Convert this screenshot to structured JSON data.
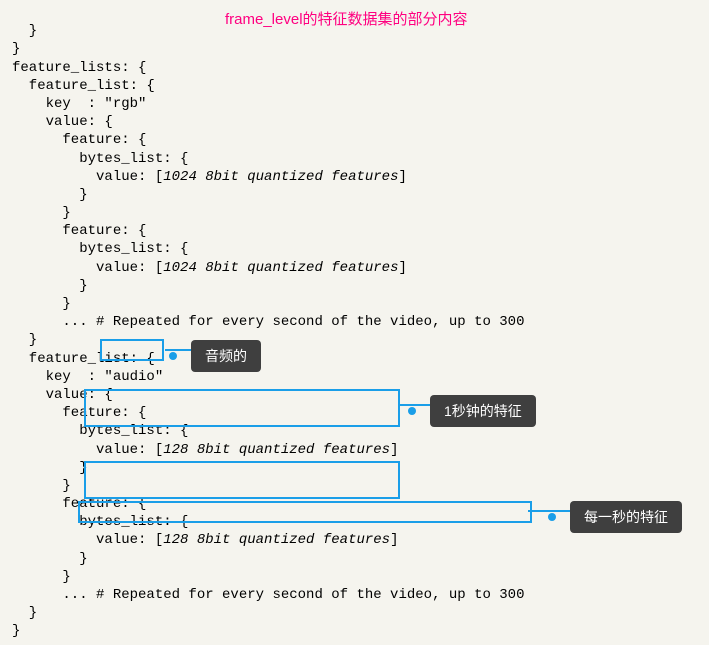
{
  "title": "frame_level的特征数据集的部分内容",
  "code": {
    "l1": "  }",
    "l2": "}",
    "l3": "feature_lists: {",
    "l4": "  feature_list: {",
    "l5": "    key  : \"rgb\"",
    "l6": "    value: {",
    "l7": "      feature: {",
    "l8": "        bytes_list: {",
    "l9": "          value: [",
    "l9v": "1024 8bit quantized features",
    "l9e": "]",
    "l10": "        }",
    "l11": "      }",
    "l12": "      feature: {",
    "l13": "        bytes_list: {",
    "l14": "          value: [",
    "l14v": "1024 8bit quantized features",
    "l14e": "]",
    "l15": "        }",
    "l16": "      }",
    "l17": "      ... # Repeated for every second of the video, up to 300",
    "l18": "  }",
    "l19": "  feature_list: {",
    "l20": "    key  : \"audio\"",
    "l21": "    value: {",
    "l22": "      feature: {",
    "l23": "        bytes_list: {",
    "l24": "          value: [",
    "l24v": "128 8bit quantized features",
    "l24e": "]",
    "l25": "        }",
    "l26": "      }",
    "l27": "      feature: {",
    "l28": "        bytes_list: {",
    "l29": "          value: [",
    "l29v": "128 8bit quantized features",
    "l29e": "]",
    "l30": "        }",
    "l31": "      }",
    "l32": "      ... # Repeated for every second of the video, up to 300",
    "l33": "  }",
    "l34": "}"
  },
  "callout": {
    "c1": "音频的",
    "c2": "1秒钟的特征",
    "c3": "每一秒的特征"
  }
}
